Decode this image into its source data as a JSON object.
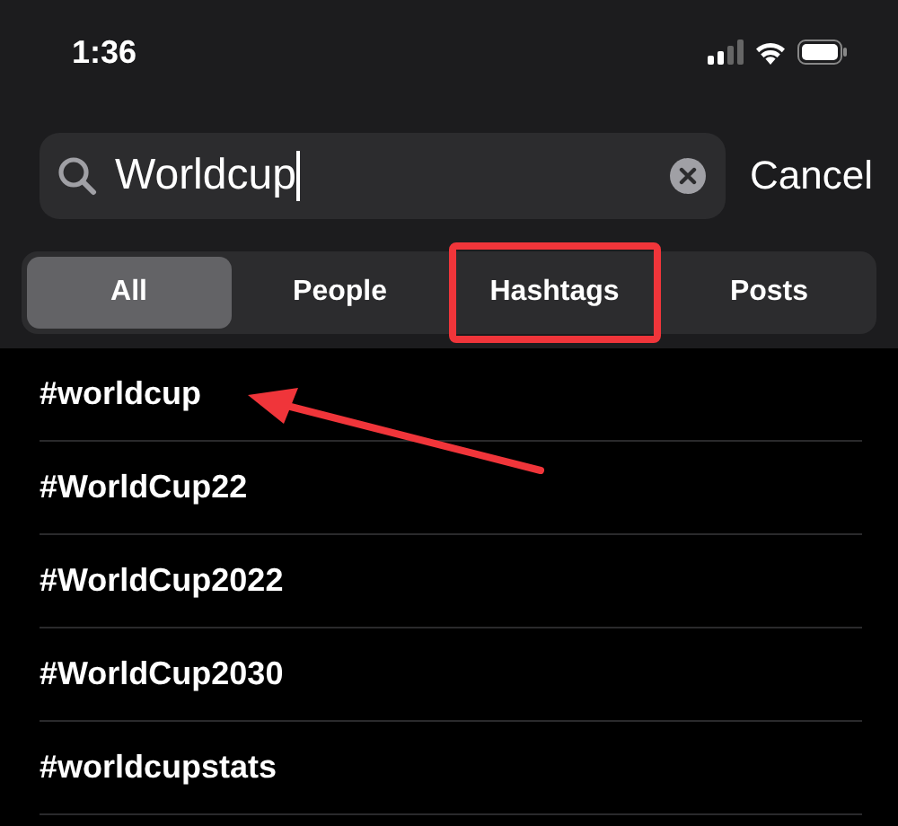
{
  "status_bar": {
    "time": "1:36"
  },
  "search": {
    "value": "Worldcup",
    "cancel": "Cancel"
  },
  "segments": [
    {
      "label": "All",
      "selected": true,
      "highlighted": false
    },
    {
      "label": "People",
      "selected": false,
      "highlighted": false
    },
    {
      "label": "Hashtags",
      "selected": false,
      "highlighted": true
    },
    {
      "label": "Posts",
      "selected": false,
      "highlighted": false
    }
  ],
  "results": [
    {
      "label": "#worldcup"
    },
    {
      "label": "#WorldCup22"
    },
    {
      "label": "#WorldCup2022"
    },
    {
      "label": "#WorldCup2030"
    },
    {
      "label": "#worldcupstats"
    }
  ]
}
